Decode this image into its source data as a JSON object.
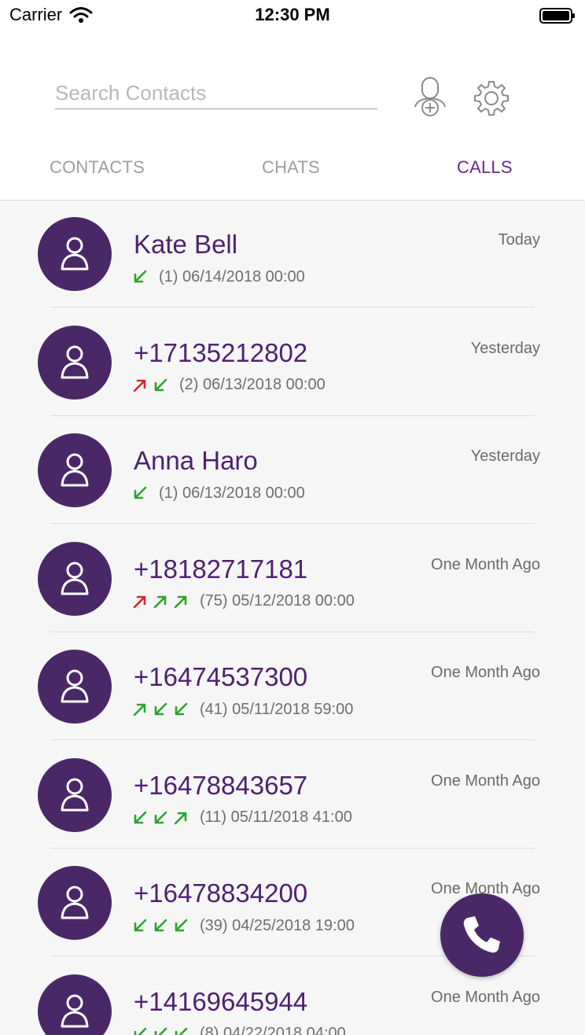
{
  "status_bar": {
    "carrier": "Carrier",
    "time": "12:30 PM"
  },
  "header": {
    "search": {
      "placeholder": "Search Contacts",
      "value": ""
    },
    "icons": {
      "add_contact": "add-contact-icon",
      "settings": "gear-icon"
    }
  },
  "tabs": [
    {
      "label": "CONTACTS",
      "active": false
    },
    {
      "label": "CHATS",
      "active": false
    },
    {
      "label": "CALLS",
      "active": true
    }
  ],
  "colors": {
    "accent": "#4a2868",
    "active_tab": "#6a2a86",
    "name": "#4d2270",
    "incoming_arrow": "#2aa52a",
    "outgoing_arrow": "#e0242c",
    "background": "#f6f6f6"
  },
  "calls": [
    {
      "name": "Kate Bell",
      "directions": [
        "in-green"
      ],
      "detail": "(1) 06/14/2018 00:00",
      "date": "Today"
    },
    {
      "name": "+17135212802",
      "directions": [
        "out-red",
        "in-green"
      ],
      "detail": "(2) 06/13/2018 00:00",
      "date": "Yesterday"
    },
    {
      "name": "Anna Haro",
      "directions": [
        "in-green"
      ],
      "detail": "(1) 06/13/2018 00:00",
      "date": "Yesterday"
    },
    {
      "name": "+18182717181",
      "directions": [
        "out-red",
        "out-green",
        "out-green"
      ],
      "detail": "(75) 05/12/2018 00:00",
      "date": "One Month Ago"
    },
    {
      "name": "+16474537300",
      "directions": [
        "out-green",
        "in-green",
        "in-green"
      ],
      "detail": "(41) 05/11/2018 59:00",
      "date": "One Month Ago"
    },
    {
      "name": "+16478843657",
      "directions": [
        "in-green",
        "in-green",
        "out-green"
      ],
      "detail": "(11) 05/11/2018 41:00",
      "date": "One Month Ago"
    },
    {
      "name": "+16478834200",
      "directions": [
        "in-green",
        "in-green",
        "in-green"
      ],
      "detail": "(39) 04/25/2018 19:00",
      "date": "One Month Ago"
    },
    {
      "name": "+14169645944",
      "directions": [
        "in-green",
        "in-green",
        "in-green"
      ],
      "detail": "(8) 04/22/2018 04:00",
      "date": "One Month Ago"
    }
  ],
  "fab": {
    "icon": "phone-icon"
  }
}
